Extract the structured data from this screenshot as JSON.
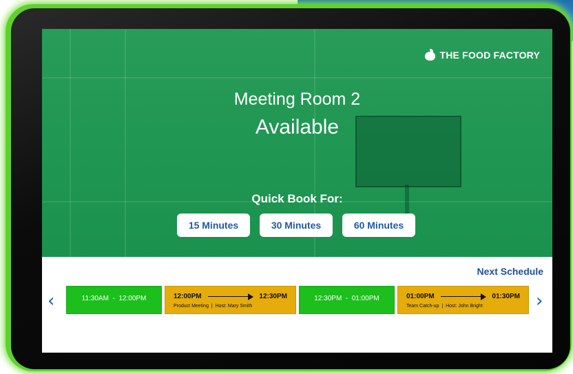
{
  "brand": {
    "name": "THE FOOD FACTORY",
    "logo_icon": "apple-icon"
  },
  "room": {
    "name": "Meeting Room 2",
    "status": "Available"
  },
  "quick_book": {
    "label": "Quick Book For:",
    "options": [
      "15 Minutes",
      "30 Minutes",
      "60 Minutes"
    ]
  },
  "schedule": {
    "header": "Next Schedule",
    "prev_icon": "chevron-left-icon",
    "next_icon": "chevron-right-icon",
    "slots": [
      {
        "state": "free",
        "text": "11:30AM  -  12:00PM"
      },
      {
        "state": "busy",
        "start": "12:00PM",
        "end": "12:30PM",
        "title": "Product Meeting",
        "host": "Host: Mary Smith"
      },
      {
        "state": "free",
        "text": "12:30PM  -  01:00PM"
      },
      {
        "state": "busy",
        "start": "01:00PM",
        "end": "01:30PM",
        "title": "Team Catch-up",
        "host": "Host: John Bright"
      }
    ]
  },
  "colors": {
    "hero_green": "#119248",
    "free_slot": "#1cbf1c",
    "busy_slot": "#e6ac0c",
    "accent_blue": "#1f5aa6",
    "frame_glow": "#5fd12e"
  }
}
